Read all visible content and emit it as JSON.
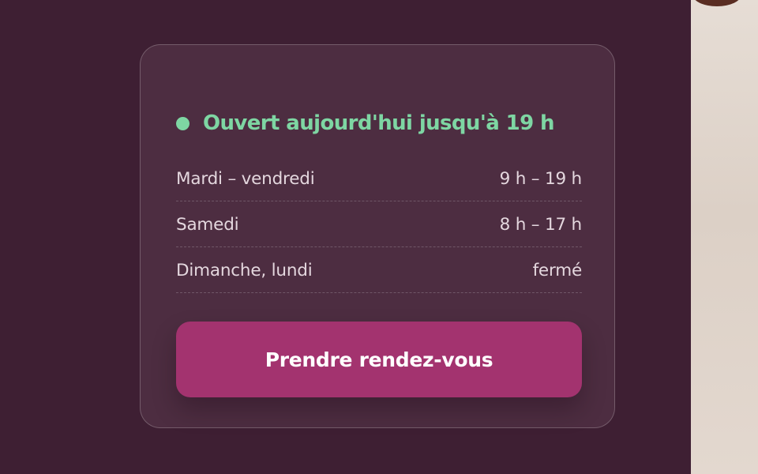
{
  "status": {
    "text": "Ouvert aujourd'hui jusqu'à 19 h",
    "color": "#7ed6a3"
  },
  "schedule": [
    {
      "days": "Mardi – vendredi",
      "hours": "9 h – 19 h"
    },
    {
      "days": "Samedi",
      "hours": "8 h – 17 h"
    },
    {
      "days": "Dimanche, lundi",
      "hours": "fermé"
    }
  ],
  "cta": {
    "label": "Prendre rendez-vous",
    "color": "#a3336f"
  },
  "colors": {
    "page_background": "#3e1f33",
    "card_background": "#4d2d41"
  }
}
